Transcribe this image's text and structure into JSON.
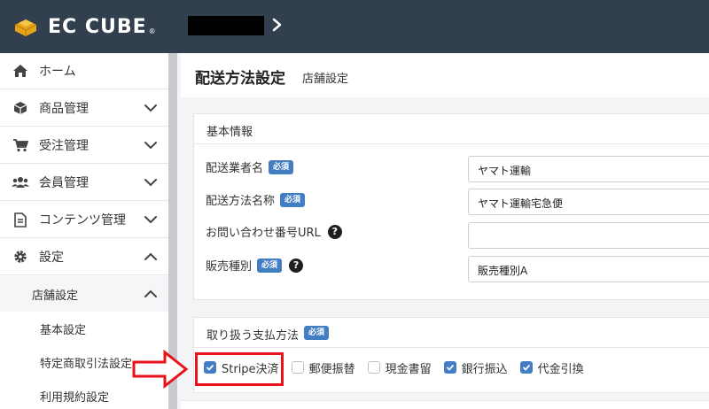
{
  "header": {
    "brand": "EC CUBE",
    "brand_reg": "®",
    "logo_icon": "cube-box-icon",
    "breadcrumb_icon": "chevron-right-icon"
  },
  "sidebar": {
    "items": [
      {
        "label": "ホーム",
        "icon": "home-icon"
      },
      {
        "label": "商品管理",
        "icon": "box-icon",
        "chevron": "down"
      },
      {
        "label": "受注管理",
        "icon": "cart-icon",
        "chevron": "down"
      },
      {
        "label": "会員管理",
        "icon": "users-icon",
        "chevron": "down"
      },
      {
        "label": "コンテンツ管理",
        "icon": "document-icon",
        "chevron": "down"
      },
      {
        "label": "設定",
        "icon": "gear-icon",
        "chevron": "up"
      }
    ],
    "sub": {
      "label": "店舗設定",
      "chevron": "up"
    },
    "subsub": [
      {
        "label": "基本設定"
      },
      {
        "label": "特定商取引法設定"
      },
      {
        "label": "利用規約設定"
      }
    ]
  },
  "page": {
    "title": "配送方法設定",
    "subtitle": "店舗設定"
  },
  "basic_card": {
    "title": "基本情報",
    "fields": [
      {
        "label": "配送業者名",
        "required": "必須",
        "value": "ヤマト運輸"
      },
      {
        "label": "配送方法名称",
        "required": "必須",
        "value": "ヤマト運輸宅急便"
      },
      {
        "label": "お問い合わせ番号URL",
        "help": "?",
        "value": ""
      },
      {
        "label": "販売種別",
        "required": "必須",
        "help": "?",
        "value": "販売種別A"
      }
    ]
  },
  "payment_card": {
    "title": "取り扱う支払方法",
    "required": "必須",
    "methods": [
      {
        "label": "Stripe決済",
        "checked": true
      },
      {
        "label": "郵便振替",
        "checked": false
      },
      {
        "label": "現金書留",
        "checked": false
      },
      {
        "label": "銀行振込",
        "checked": true
      },
      {
        "label": "代金引換",
        "checked": true
      }
    ]
  },
  "colors": {
    "header_bg": "#323f4f",
    "accent": "#437ec4",
    "highlight": "#e8121b"
  }
}
